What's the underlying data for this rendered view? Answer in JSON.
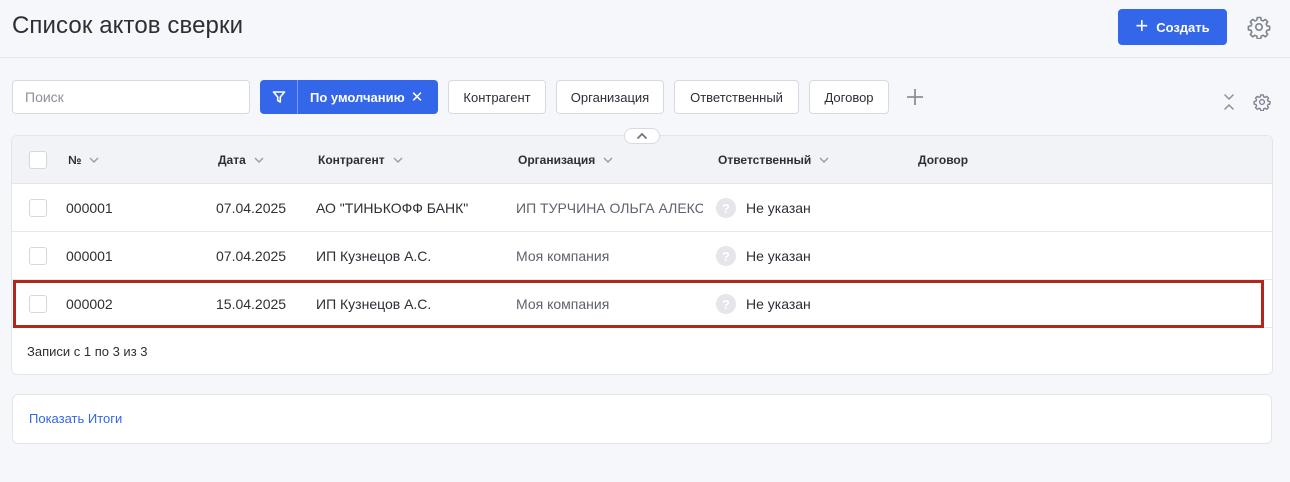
{
  "header": {
    "title": "Список актов сверки",
    "create_label": "Создать",
    "create_icon": "plus-icon"
  },
  "toolbar": {
    "search_placeholder": "Поиск",
    "search_value": "",
    "active_filter": "По умолчанию",
    "filters": [
      "Контрагент",
      "Организация",
      "Ответственный",
      "Договор"
    ]
  },
  "table": {
    "columns": [
      "№",
      "Дата",
      "Контрагент",
      "Организация",
      "Ответственный",
      "Договор"
    ],
    "rows": [
      {
        "num": "000001",
        "date": "07.04.2025",
        "counterparty": "АО \"ТИНЬКОФФ БАНК\"",
        "organization": "ИП ТУРЧИНА ОЛЬГА АЛЕКСЕ",
        "responsible": "Не указан",
        "contract": ""
      },
      {
        "num": "000001",
        "date": "07.04.2025",
        "counterparty": "ИП Кузнецов А.С.",
        "organization": "Моя компания",
        "responsible": "Не указан",
        "contract": ""
      },
      {
        "num": "000002",
        "date": "15.04.2025",
        "counterparty": "ИП Кузнецов А.С.",
        "organization": "Моя компания",
        "responsible": "Не указан",
        "contract": ""
      }
    ],
    "records_text": "Записи с 1 по 3 из 3",
    "responsible_placeholder_glyph": "?"
  },
  "totals": {
    "link": "Показать Итоги"
  },
  "colors": {
    "accent": "#3366e8",
    "highlight": "#b3261e",
    "background": "#f6f7fb"
  }
}
